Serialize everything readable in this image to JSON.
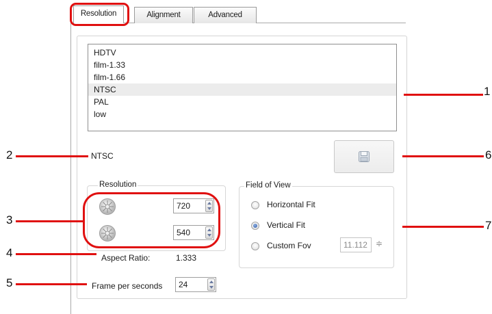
{
  "tabs": [
    {
      "label": "Resolution"
    },
    {
      "label": "Alignment"
    },
    {
      "label": "Advanced"
    }
  ],
  "presets": {
    "items": [
      "HDTV",
      "film-1.33",
      "film-1.66",
      "NTSC",
      "PAL",
      "low"
    ],
    "selected": "NTSC"
  },
  "preset_name": "NTSC",
  "save_button": {
    "icon": "floppy-disk-icon"
  },
  "resolution": {
    "title": "Resolution",
    "width": "720",
    "height": "540",
    "aspect_label": "Aspect Ratio:",
    "aspect_value": "1.333"
  },
  "fov": {
    "title": "Field of View",
    "options": [
      {
        "label": "Horizontal Fit",
        "checked": false
      },
      {
        "label": "Vertical Fit",
        "checked": true
      },
      {
        "label": "Custom Fov",
        "checked": false
      }
    ],
    "custom_value": "11.112",
    "custom_spin_glyph": "≑"
  },
  "fps": {
    "label": "Frame per seconds",
    "value": "24"
  },
  "callouts": {
    "n1": "1",
    "n2": "2",
    "n3": "3",
    "n4": "4",
    "n5": "5",
    "n6": "6",
    "n7": "7",
    "color": "#e01010"
  }
}
